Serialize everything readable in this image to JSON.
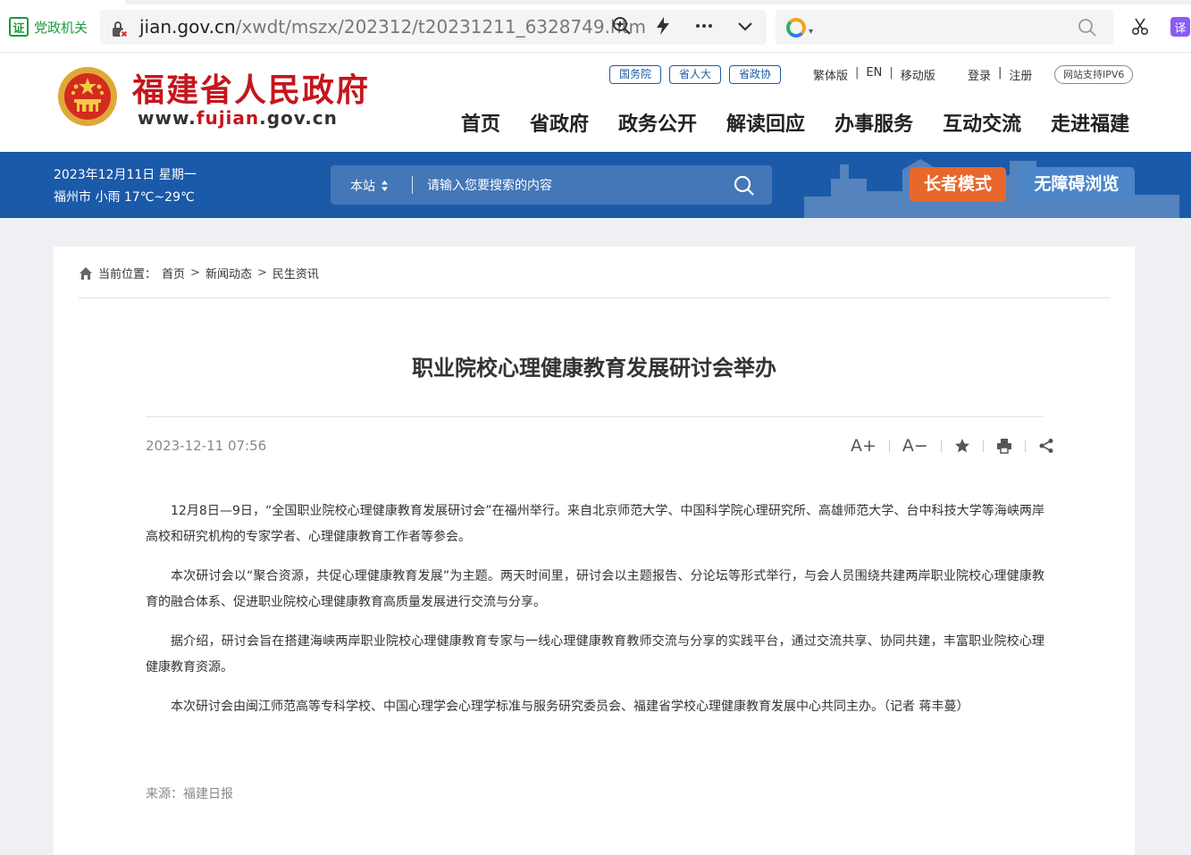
{
  "browser": {
    "cert_label": "党政机关",
    "cert_glyph": "证",
    "url_host": "jian.gov.cn",
    "url_path": "/xwdt/mszx/202312/t20231211_6328749.htm",
    "translate_label": "译"
  },
  "header": {
    "site_name": "福建省人民政府",
    "domain_prefix": "www.",
    "domain_accent": "fujian",
    "domain_suffix": ".gov.cn",
    "gov_links": [
      "国务院",
      "省人大",
      "省政协"
    ],
    "util_links": [
      "繁体版",
      "EN",
      "移动版"
    ],
    "account_links": [
      "登录",
      "注册"
    ],
    "ipv6_label": "网站支持IPV6",
    "nav": [
      "首页",
      "省政府",
      "政务公开",
      "解读回应",
      "办事服务",
      "互动交流",
      "走进福建"
    ]
  },
  "band": {
    "date": "2023年12月11日 星期一",
    "weather": "福州市 小雨 17℃~29℃",
    "search_scope": "本站",
    "search_placeholder": "请输入您要搜索的内容",
    "elder_mode": "长者模式",
    "accessible_mode": "无障碍浏览"
  },
  "breadcrumb": {
    "prefix": "当前位置：",
    "items": [
      "首页",
      "新闻动态",
      "民生资讯"
    ]
  },
  "article": {
    "title": "职业院校心理健康教育发展研讨会举办",
    "published": "2023-12-11 07:56",
    "tools": {
      "font_increase": "A+",
      "font_decrease": "A−"
    },
    "paragraphs": [
      "12月8日—9日，“全国职业院校心理健康教育发展研讨会”在福州举行。来自北京师范大学、中国科学院心理研究所、高雄师范大学、台中科技大学等海峡两岸高校和研究机构的专家学者、心理健康教育工作者等参会。",
      "本次研讨会以“聚合资源，共促心理健康教育发展”为主题。两天时间里，研讨会以主题报告、分论坛等形式举行，与会人员围绕共建两岸职业院校心理健康教育的融合体系、促进职业院校心理健康教育高质量发展进行交流与分享。",
      "据介绍，研讨会旨在搭建海峡两岸职业院校心理健康教育专家与一线心理健康教育教师交流与分享的实践平台，通过交流共享、协同共建，丰富职业院校心理健康教育资源。",
      "本次研讨会由闽江师范高等专科学校、中国心理学会心理学标准与服务研究委员会、福建省学校心理健康教育发展中心共同主办。（记者  蒋丰蔓）"
    ],
    "source": "来源：福建日报"
  },
  "colors": {
    "brand_red": "#c4161c",
    "band_blue": "#1a5aa8",
    "elder_orange": "#e8672b",
    "access_blue": "#4c86c9"
  }
}
